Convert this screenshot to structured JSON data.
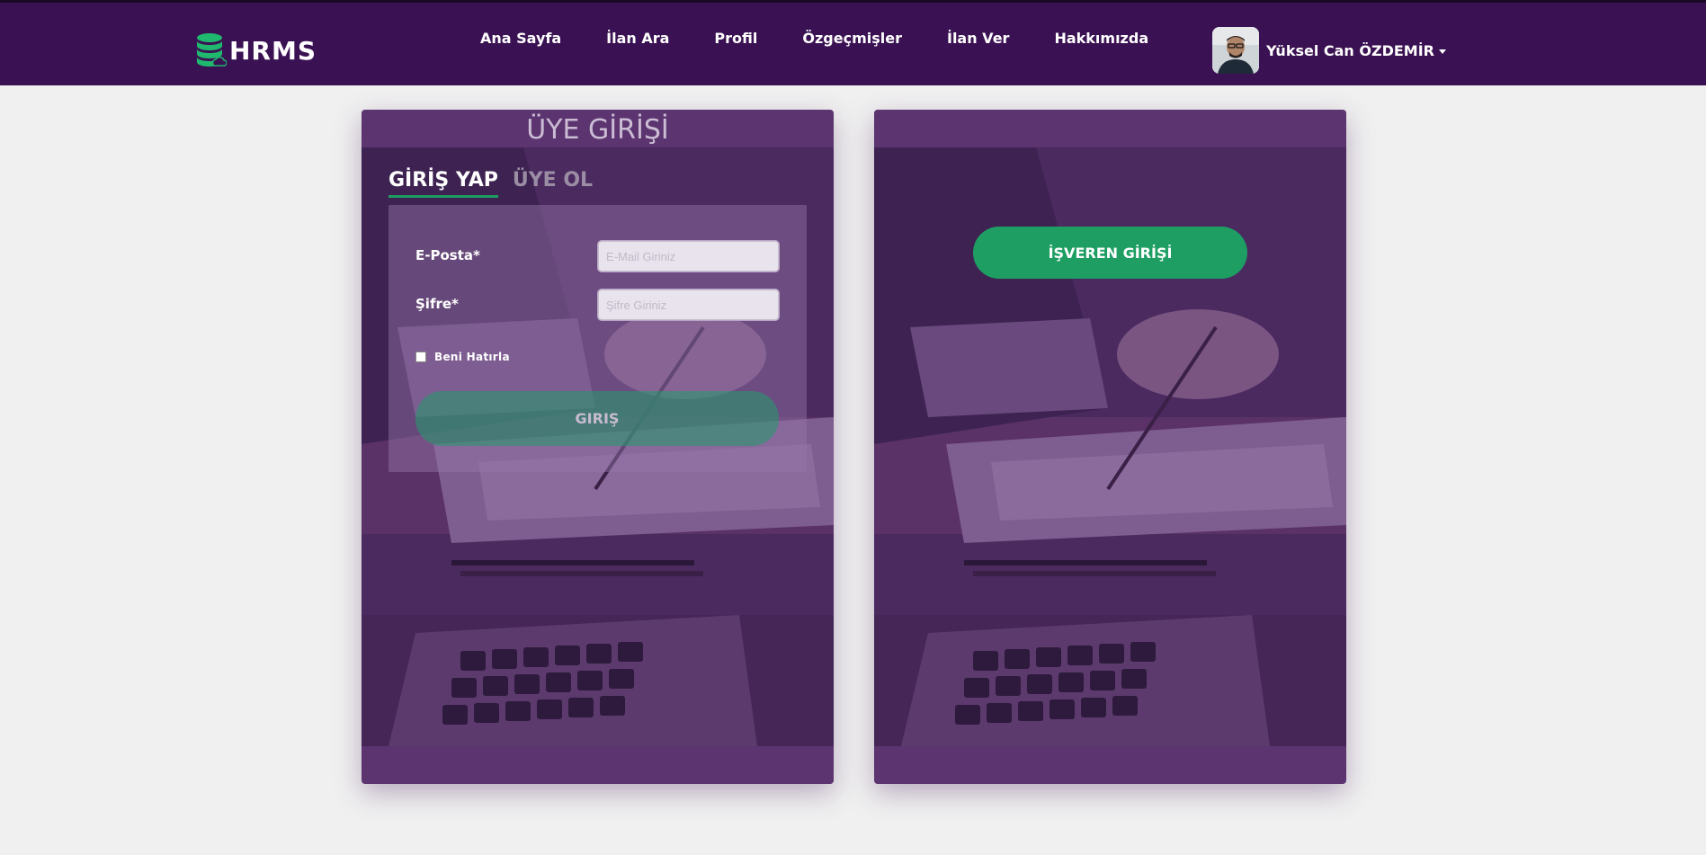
{
  "navbar": {
    "brand": "HRMS",
    "links": [
      "Ana Sayfa",
      "İlan Ara",
      "Profil",
      "Özgeçmişler",
      "İlan Ver",
      "Hakkımızda"
    ],
    "user_name": "Yüksel Can ÖZDEMİR"
  },
  "member_panel": {
    "title": "ÜYE GİRİŞİ",
    "tabs": [
      "GİRİŞ YAP",
      "ÜYE OL"
    ],
    "email_label": "E-Posta*",
    "email_placeholder": "E-Mail Giriniz",
    "password_label": "Şifre*",
    "password_placeholder": "Şifre Giriniz",
    "remember_label": "Beni Hatırla",
    "login_button": "GIRIŞ"
  },
  "employer_panel": {
    "login_button": "İŞVEREN GİRİŞİ"
  },
  "colors": {
    "navbar_bg": "#3a1152",
    "panel_bg": "#5b3470",
    "accent_green": "#1e9e63",
    "page_bg": "#f0f0f0"
  },
  "icons": {
    "logo": "database-cloud-icon",
    "caret": "chevron-down-icon"
  }
}
